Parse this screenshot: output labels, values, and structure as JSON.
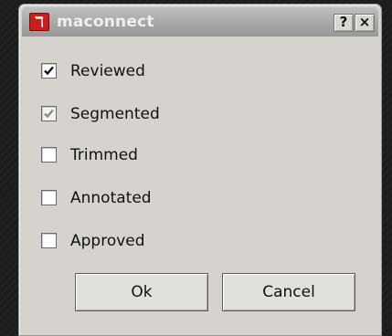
{
  "window": {
    "title": "maconnect",
    "icon": "app-logo-icon",
    "help_label": "?",
    "close_label": "×"
  },
  "checkboxes": [
    {
      "label": "Reviewed",
      "checked": true,
      "enabled": true
    },
    {
      "label": "Segmented",
      "checked": true,
      "enabled": false
    },
    {
      "label": "Trimmed",
      "checked": false,
      "enabled": true
    },
    {
      "label": "Annotated",
      "checked": false,
      "enabled": true
    },
    {
      "label": "Approved",
      "checked": false,
      "enabled": true
    }
  ],
  "buttons": {
    "ok_label": "Ok",
    "cancel_label": "Cancel"
  },
  "colors": {
    "titlebar": "#a9a9a9",
    "dialog_bg": "#d6d3ce",
    "icon_red": "#c81e1e"
  }
}
